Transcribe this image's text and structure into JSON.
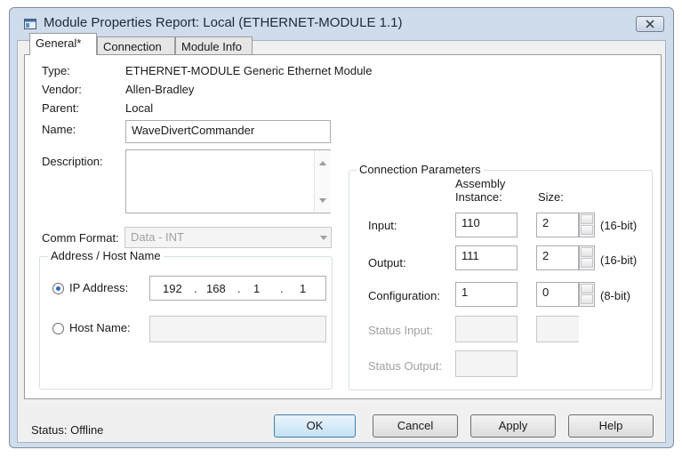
{
  "window": {
    "title": "Module Properties Report: Local (ETHERNET-MODULE 1.1)"
  },
  "tabs": [
    {
      "label": "General*"
    },
    {
      "label": "Connection"
    },
    {
      "label": "Module Info"
    }
  ],
  "general": {
    "type_label": "Type:",
    "type_value": "ETHERNET-MODULE Generic Ethernet Module",
    "vendor_label": "Vendor:",
    "vendor_value": "Allen-Bradley",
    "parent_label": "Parent:",
    "parent_value": "Local",
    "name_label": "Name:",
    "name_value": "WaveDivertCommander",
    "description_label": "Description:",
    "description_value": "",
    "comm_format_label": "Comm Format:",
    "comm_format_value": "Data - INT"
  },
  "address": {
    "group_title": "Address / Host Name",
    "ip_label": "IP Address:",
    "ip": [
      "192",
      "168",
      "1",
      "1"
    ],
    "host_label": "Host Name:",
    "host_value": ""
  },
  "connection": {
    "group_title": "Connection Parameters",
    "assembly_header_1": "Assembly",
    "assembly_header_2": "Instance:",
    "size_header": "Size:",
    "rows": [
      {
        "label": "Input:",
        "instance": "110",
        "size": "2",
        "unit": "(16-bit)"
      },
      {
        "label": "Output:",
        "instance": "111",
        "size": "2",
        "unit": "(16-bit)"
      },
      {
        "label": "Configuration:",
        "instance": "1",
        "size": "0",
        "unit": "(8-bit)"
      }
    ],
    "status_input_label": "Status Input:",
    "status_output_label": "Status Output:"
  },
  "footer": {
    "status_text": "Status:  Offline",
    "ok_label": "OK",
    "cancel_label": "Cancel",
    "apply_label": "Apply",
    "help_label": "Help"
  }
}
